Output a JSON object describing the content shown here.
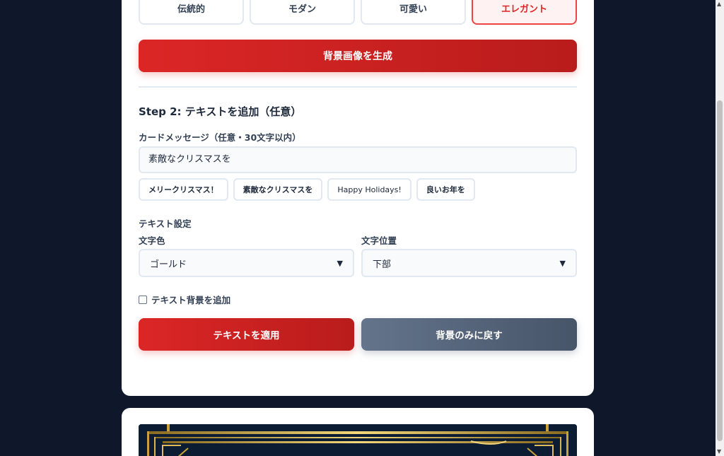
{
  "styles": [
    {
      "label": "伝統的",
      "active": false
    },
    {
      "label": "モダン",
      "active": false
    },
    {
      "label": "可愛い",
      "active": false
    },
    {
      "label": "エレガント",
      "active": true
    }
  ],
  "generate_button": "背景画像を生成",
  "step2": {
    "title": "Step 2: テキストを追加（任意）",
    "message_label": "カードメッセージ（任意・30文字以内）",
    "message_value": "素敵なクリスマスを",
    "presets": [
      "メリークリスマス！",
      "素敵なクリスマスを",
      "Happy Holidays!",
      "良いお年を"
    ],
    "text_settings_label": "テキスト設定",
    "color_label": "文字色",
    "color_value": "ゴールド",
    "position_label": "文字位置",
    "position_value": "下部",
    "text_bg_label": "テキスト背景を追加",
    "text_bg_checked": false,
    "apply_button": "テキストを適用",
    "reset_button": "背景のみに戻す"
  },
  "colors": {
    "accent": "#dc2626",
    "background": "#0f172a",
    "gray_button": "#64748b"
  }
}
